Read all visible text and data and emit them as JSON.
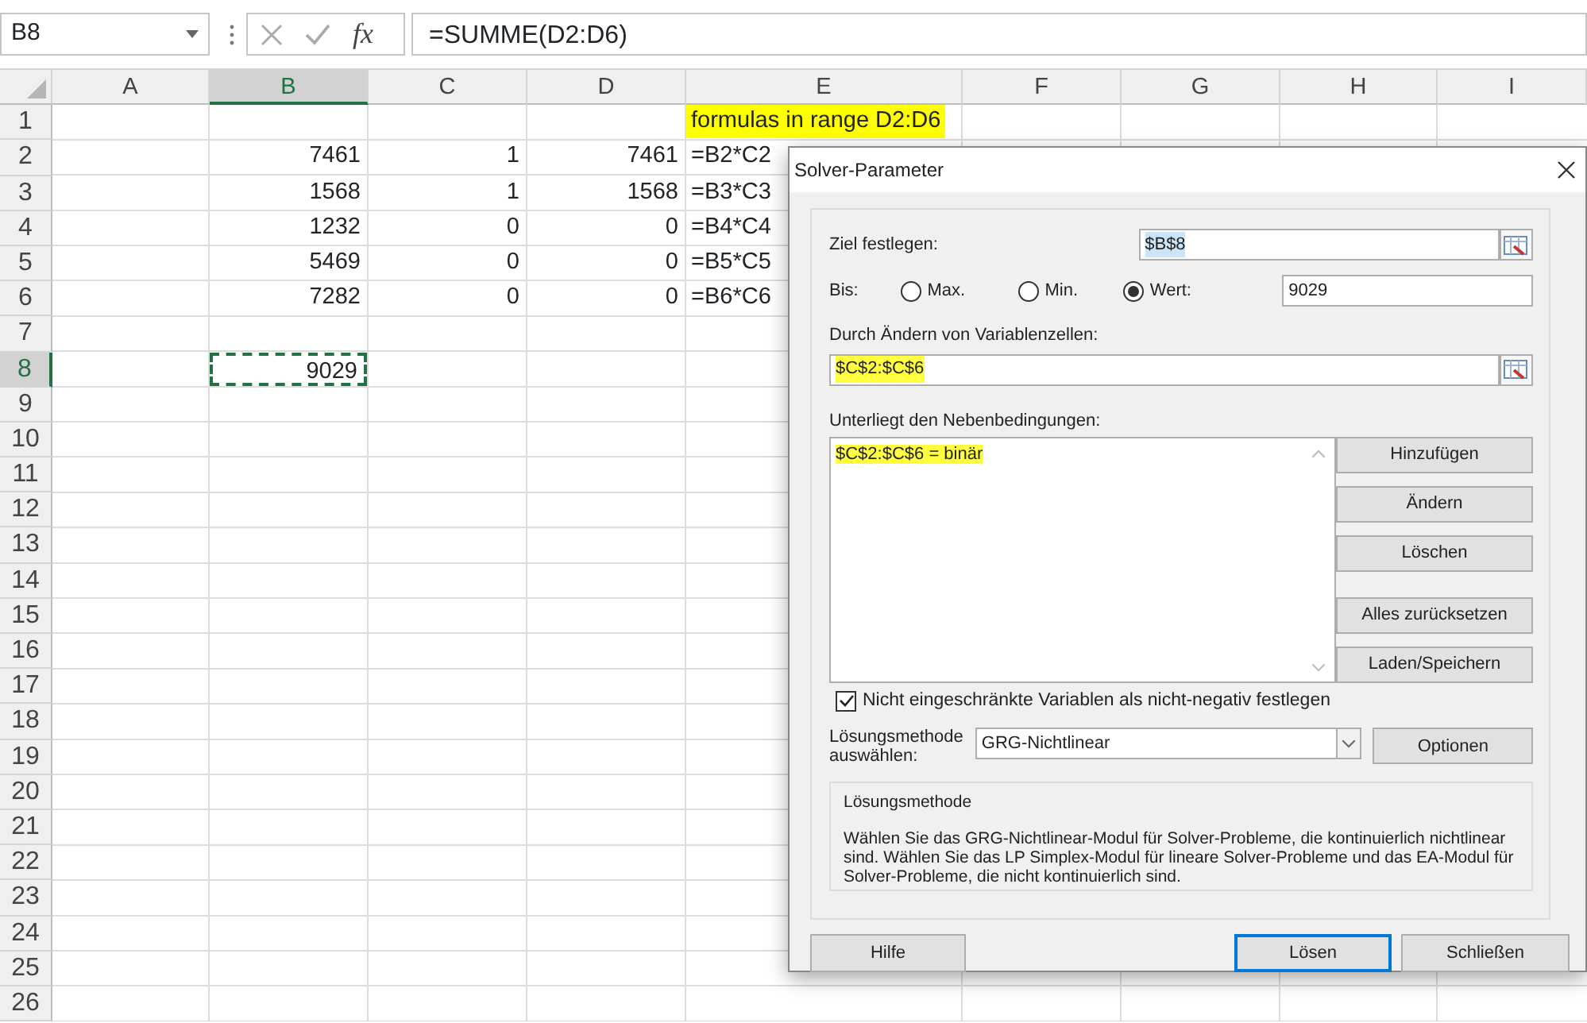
{
  "formula_bar": {
    "name_box": "B8",
    "function_label": "fx",
    "formula": "=SUMME(D2:D6)"
  },
  "sheet": {
    "columns": [
      {
        "label": "A",
        "selected": false
      },
      {
        "label": "B",
        "selected": true
      },
      {
        "label": "C",
        "selected": false
      },
      {
        "label": "D",
        "selected": false
      },
      {
        "label": "E",
        "selected": false
      },
      {
        "label": "F",
        "selected": false
      },
      {
        "label": "G",
        "selected": false
      },
      {
        "label": "H",
        "selected": false
      },
      {
        "label": "I",
        "selected": false
      }
    ],
    "rows": [
      {
        "label": "1",
        "selected": false,
        "cells": [
          null,
          null,
          null,
          null,
          {
            "text": "formulas in range D2:D6",
            "kind": "text",
            "highlighted": true,
            "selected": false
          }
        ]
      },
      {
        "label": "2",
        "selected": false,
        "cells": [
          null,
          {
            "text": "7461",
            "kind": "number",
            "highlighted": false,
            "selected": false
          },
          {
            "text": "1",
            "kind": "number",
            "highlighted": false,
            "selected": false
          },
          {
            "text": "7461",
            "kind": "number",
            "highlighted": false,
            "selected": false
          },
          {
            "text": "=B2*C2",
            "kind": "text",
            "highlighted": false,
            "selected": false
          }
        ]
      },
      {
        "label": "3",
        "selected": false,
        "cells": [
          null,
          {
            "text": "1568",
            "kind": "number",
            "highlighted": false,
            "selected": false
          },
          {
            "text": "1",
            "kind": "number",
            "highlighted": false,
            "selected": false
          },
          {
            "text": "1568",
            "kind": "number",
            "highlighted": false,
            "selected": false
          },
          {
            "text": "=B3*C3",
            "kind": "text",
            "highlighted": false,
            "selected": false
          }
        ]
      },
      {
        "label": "4",
        "selected": false,
        "cells": [
          null,
          {
            "text": "1232",
            "kind": "number",
            "highlighted": false,
            "selected": false
          },
          {
            "text": "0",
            "kind": "number",
            "highlighted": false,
            "selected": false
          },
          {
            "text": "0",
            "kind": "number",
            "highlighted": false,
            "selected": false
          },
          {
            "text": "=B4*C4",
            "kind": "text",
            "highlighted": false,
            "selected": false
          }
        ]
      },
      {
        "label": "5",
        "selected": false,
        "cells": [
          null,
          {
            "text": "5469",
            "kind": "number",
            "highlighted": false,
            "selected": false
          },
          {
            "text": "0",
            "kind": "number",
            "highlighted": false,
            "selected": false
          },
          {
            "text": "0",
            "kind": "number",
            "highlighted": false,
            "selected": false
          },
          {
            "text": "=B5*C5",
            "kind": "text",
            "highlighted": false,
            "selected": false
          }
        ]
      },
      {
        "label": "6",
        "selected": false,
        "cells": [
          null,
          {
            "text": "7282",
            "kind": "number",
            "highlighted": false,
            "selected": false
          },
          {
            "text": "0",
            "kind": "number",
            "highlighted": false,
            "selected": false
          },
          {
            "text": "0",
            "kind": "number",
            "highlighted": false,
            "selected": false
          },
          {
            "text": "=B6*C6",
            "kind": "text",
            "highlighted": false,
            "selected": false
          }
        ]
      },
      {
        "label": "7",
        "selected": false
      },
      {
        "label": "8",
        "selected": true,
        "cells": [
          null,
          {
            "text": "9029",
            "kind": "number",
            "highlighted": false,
            "selected": true
          }
        ]
      },
      {
        "label": "9",
        "selected": false
      },
      {
        "label": "10",
        "selected": false
      },
      {
        "label": "11",
        "selected": false
      },
      {
        "label": "12",
        "selected": false
      },
      {
        "label": "13",
        "selected": false
      },
      {
        "label": "14",
        "selected": false
      },
      {
        "label": "15",
        "selected": false
      },
      {
        "label": "16",
        "selected": false
      },
      {
        "label": "17",
        "selected": false
      },
      {
        "label": "18",
        "selected": false
      },
      {
        "label": "19",
        "selected": false
      },
      {
        "label": "20",
        "selected": false
      },
      {
        "label": "21",
        "selected": false
      },
      {
        "label": "22",
        "selected": false
      },
      {
        "label": "23",
        "selected": false
      },
      {
        "label": "24",
        "selected": false
      },
      {
        "label": "25",
        "selected": false
      },
      {
        "label": "26",
        "selected": false
      }
    ]
  },
  "dialog": {
    "title": "Solver-Parameter",
    "objective": {
      "label": "Ziel festlegen:",
      "value": "$B$8"
    },
    "target": {
      "label": "Bis:",
      "options": [
        {
          "label": "Max.",
          "selected": false
        },
        {
          "label": "Min.",
          "selected": false
        },
        {
          "label": "Wert:",
          "selected": true
        }
      ],
      "value": "9029"
    },
    "variables": {
      "label": "Durch Ändern von Variablenzellen:",
      "value": "$C$2:$C$6",
      "highlighted": true
    },
    "constraints": {
      "label": "Unterliegt den Nebenbedingungen:",
      "items": [
        {
          "text": "$C$2:$C$6 = binär",
          "highlighted": true
        }
      ]
    },
    "side_buttons": [
      "Hinzufügen",
      "Ändern",
      "Löschen",
      "Alles zurücksetzen",
      "Laden/Speichern"
    ],
    "nonnegative": {
      "label": "Nicht eingeschränkte Variablen als nicht-negativ festlegen",
      "checked": true
    },
    "method": {
      "label": "Lösungsmethode auswählen:",
      "value": "GRG-Nichtlinear",
      "button": "Optionen"
    },
    "description": {
      "title": "Lösungsmethode",
      "text": "Wählen Sie das GRG-Nichtlinear-Modul für Solver-Probleme, die kontinuierlich nichtlinear sind. Wählen Sie das LP Simplex-Modul für lineare Solver-Probleme und das EA-Modul für Solver-Probleme, die nicht kontinuierlich sind."
    },
    "footer_buttons": [
      {
        "label": "Hilfe",
        "focused": false
      },
      {
        "label": "Lösen",
        "focused": true
      },
      {
        "label": "Schließen",
        "focused": false
      }
    ]
  }
}
